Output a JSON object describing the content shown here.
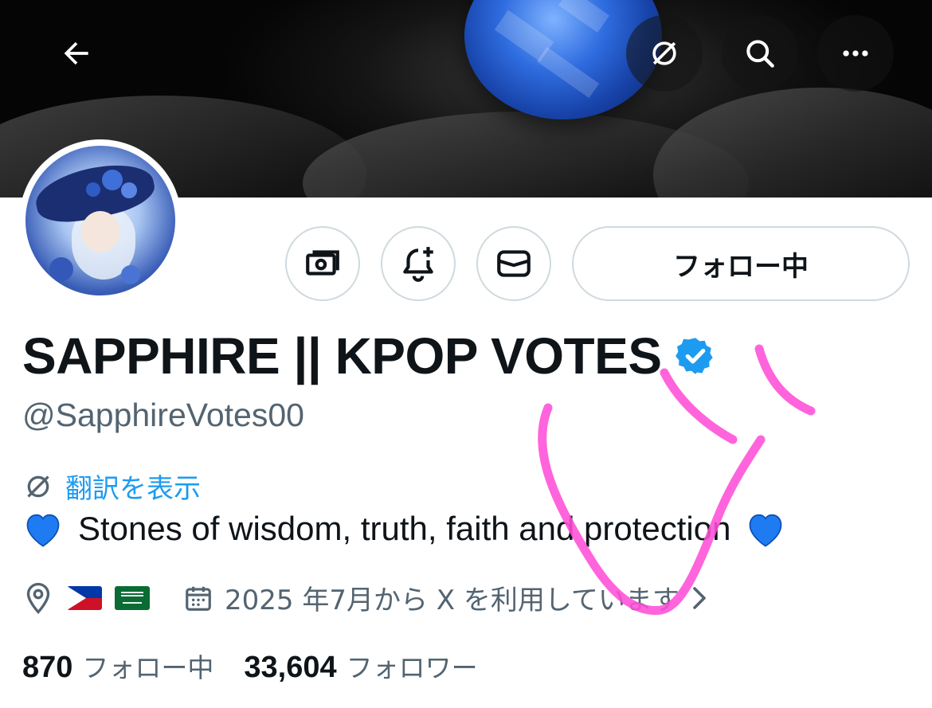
{
  "header": {
    "back_icon": "arrow-left-icon",
    "translate_icon": "translate-icon",
    "search_icon": "search-icon",
    "more_icon": "more-icon"
  },
  "profile": {
    "display_name": "SAPPHIRE || KPOP VOTES",
    "handle": "@SapphireVotes00",
    "verified": true,
    "verified_color": "#1d9bf0"
  },
  "actions": {
    "tip_icon": "money-icon",
    "notify_icon": "bell-plus-icon",
    "message_icon": "envelope-icon",
    "follow_label": "フォロー中"
  },
  "translate_label": "翻訳を表示",
  "bio": {
    "text": "Stones of wisdom, truth, faith and protection",
    "emoji": "blue-heart"
  },
  "meta": {
    "location_icon": "location-pin-icon",
    "flags": [
      "philippines-flag",
      "saudi-arabia-flag"
    ],
    "joined": "2025 年7月から X を利用しています"
  },
  "stats": {
    "following_count": "870",
    "following_label": "フォロー中",
    "followers_count": "33,604",
    "followers_label": "フォロワー"
  },
  "colors": {
    "text_primary": "#0f1419",
    "text_secondary": "#536471",
    "link": "#1d9bf0",
    "border": "#cfd9de",
    "scribble": "#ff4fd8"
  }
}
